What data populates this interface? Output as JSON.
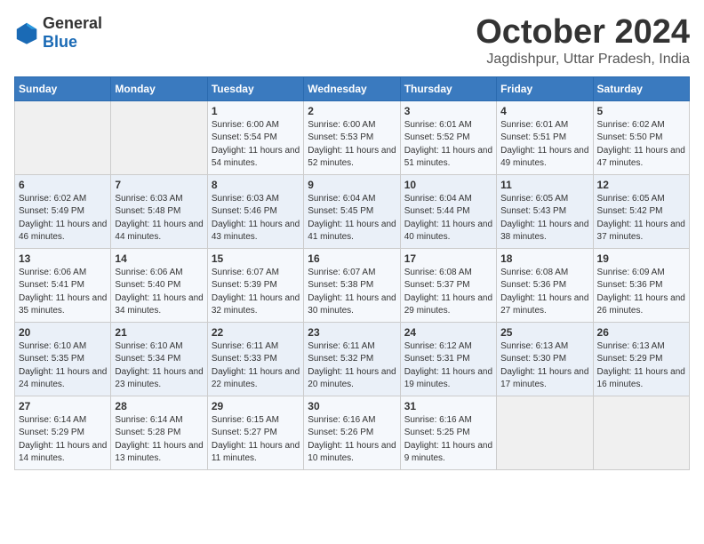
{
  "logo": {
    "general": "General",
    "blue": "Blue"
  },
  "title": "October 2024",
  "location": "Jagdishpur, Uttar Pradesh, India",
  "header_days": [
    "Sunday",
    "Monday",
    "Tuesday",
    "Wednesday",
    "Thursday",
    "Friday",
    "Saturday"
  ],
  "weeks": [
    [
      {
        "day": "",
        "sunrise": "",
        "sunset": "",
        "daylight": ""
      },
      {
        "day": "",
        "sunrise": "",
        "sunset": "",
        "daylight": ""
      },
      {
        "day": "1",
        "sunrise": "Sunrise: 6:00 AM",
        "sunset": "Sunset: 5:54 PM",
        "daylight": "Daylight: 11 hours and 54 minutes."
      },
      {
        "day": "2",
        "sunrise": "Sunrise: 6:00 AM",
        "sunset": "Sunset: 5:53 PM",
        "daylight": "Daylight: 11 hours and 52 minutes."
      },
      {
        "day": "3",
        "sunrise": "Sunrise: 6:01 AM",
        "sunset": "Sunset: 5:52 PM",
        "daylight": "Daylight: 11 hours and 51 minutes."
      },
      {
        "day": "4",
        "sunrise": "Sunrise: 6:01 AM",
        "sunset": "Sunset: 5:51 PM",
        "daylight": "Daylight: 11 hours and 49 minutes."
      },
      {
        "day": "5",
        "sunrise": "Sunrise: 6:02 AM",
        "sunset": "Sunset: 5:50 PM",
        "daylight": "Daylight: 11 hours and 47 minutes."
      }
    ],
    [
      {
        "day": "6",
        "sunrise": "Sunrise: 6:02 AM",
        "sunset": "Sunset: 5:49 PM",
        "daylight": "Daylight: 11 hours and 46 minutes."
      },
      {
        "day": "7",
        "sunrise": "Sunrise: 6:03 AM",
        "sunset": "Sunset: 5:48 PM",
        "daylight": "Daylight: 11 hours and 44 minutes."
      },
      {
        "day": "8",
        "sunrise": "Sunrise: 6:03 AM",
        "sunset": "Sunset: 5:46 PM",
        "daylight": "Daylight: 11 hours and 43 minutes."
      },
      {
        "day": "9",
        "sunrise": "Sunrise: 6:04 AM",
        "sunset": "Sunset: 5:45 PM",
        "daylight": "Daylight: 11 hours and 41 minutes."
      },
      {
        "day": "10",
        "sunrise": "Sunrise: 6:04 AM",
        "sunset": "Sunset: 5:44 PM",
        "daylight": "Daylight: 11 hours and 40 minutes."
      },
      {
        "day": "11",
        "sunrise": "Sunrise: 6:05 AM",
        "sunset": "Sunset: 5:43 PM",
        "daylight": "Daylight: 11 hours and 38 minutes."
      },
      {
        "day": "12",
        "sunrise": "Sunrise: 6:05 AM",
        "sunset": "Sunset: 5:42 PM",
        "daylight": "Daylight: 11 hours and 37 minutes."
      }
    ],
    [
      {
        "day": "13",
        "sunrise": "Sunrise: 6:06 AM",
        "sunset": "Sunset: 5:41 PM",
        "daylight": "Daylight: 11 hours and 35 minutes."
      },
      {
        "day": "14",
        "sunrise": "Sunrise: 6:06 AM",
        "sunset": "Sunset: 5:40 PM",
        "daylight": "Daylight: 11 hours and 34 minutes."
      },
      {
        "day": "15",
        "sunrise": "Sunrise: 6:07 AM",
        "sunset": "Sunset: 5:39 PM",
        "daylight": "Daylight: 11 hours and 32 minutes."
      },
      {
        "day": "16",
        "sunrise": "Sunrise: 6:07 AM",
        "sunset": "Sunset: 5:38 PM",
        "daylight": "Daylight: 11 hours and 30 minutes."
      },
      {
        "day": "17",
        "sunrise": "Sunrise: 6:08 AM",
        "sunset": "Sunset: 5:37 PM",
        "daylight": "Daylight: 11 hours and 29 minutes."
      },
      {
        "day": "18",
        "sunrise": "Sunrise: 6:08 AM",
        "sunset": "Sunset: 5:36 PM",
        "daylight": "Daylight: 11 hours and 27 minutes."
      },
      {
        "day": "19",
        "sunrise": "Sunrise: 6:09 AM",
        "sunset": "Sunset: 5:36 PM",
        "daylight": "Daylight: 11 hours and 26 minutes."
      }
    ],
    [
      {
        "day": "20",
        "sunrise": "Sunrise: 6:10 AM",
        "sunset": "Sunset: 5:35 PM",
        "daylight": "Daylight: 11 hours and 24 minutes."
      },
      {
        "day": "21",
        "sunrise": "Sunrise: 6:10 AM",
        "sunset": "Sunset: 5:34 PM",
        "daylight": "Daylight: 11 hours and 23 minutes."
      },
      {
        "day": "22",
        "sunrise": "Sunrise: 6:11 AM",
        "sunset": "Sunset: 5:33 PM",
        "daylight": "Daylight: 11 hours and 22 minutes."
      },
      {
        "day": "23",
        "sunrise": "Sunrise: 6:11 AM",
        "sunset": "Sunset: 5:32 PM",
        "daylight": "Daylight: 11 hours and 20 minutes."
      },
      {
        "day": "24",
        "sunrise": "Sunrise: 6:12 AM",
        "sunset": "Sunset: 5:31 PM",
        "daylight": "Daylight: 11 hours and 19 minutes."
      },
      {
        "day": "25",
        "sunrise": "Sunrise: 6:13 AM",
        "sunset": "Sunset: 5:30 PM",
        "daylight": "Daylight: 11 hours and 17 minutes."
      },
      {
        "day": "26",
        "sunrise": "Sunrise: 6:13 AM",
        "sunset": "Sunset: 5:29 PM",
        "daylight": "Daylight: 11 hours and 16 minutes."
      }
    ],
    [
      {
        "day": "27",
        "sunrise": "Sunrise: 6:14 AM",
        "sunset": "Sunset: 5:29 PM",
        "daylight": "Daylight: 11 hours and 14 minutes."
      },
      {
        "day": "28",
        "sunrise": "Sunrise: 6:14 AM",
        "sunset": "Sunset: 5:28 PM",
        "daylight": "Daylight: 11 hours and 13 minutes."
      },
      {
        "day": "29",
        "sunrise": "Sunrise: 6:15 AM",
        "sunset": "Sunset: 5:27 PM",
        "daylight": "Daylight: 11 hours and 11 minutes."
      },
      {
        "day": "30",
        "sunrise": "Sunrise: 6:16 AM",
        "sunset": "Sunset: 5:26 PM",
        "daylight": "Daylight: 11 hours and 10 minutes."
      },
      {
        "day": "31",
        "sunrise": "Sunrise: 6:16 AM",
        "sunset": "Sunset: 5:25 PM",
        "daylight": "Daylight: 11 hours and 9 minutes."
      },
      {
        "day": "",
        "sunrise": "",
        "sunset": "",
        "daylight": ""
      },
      {
        "day": "",
        "sunrise": "",
        "sunset": "",
        "daylight": ""
      }
    ]
  ]
}
